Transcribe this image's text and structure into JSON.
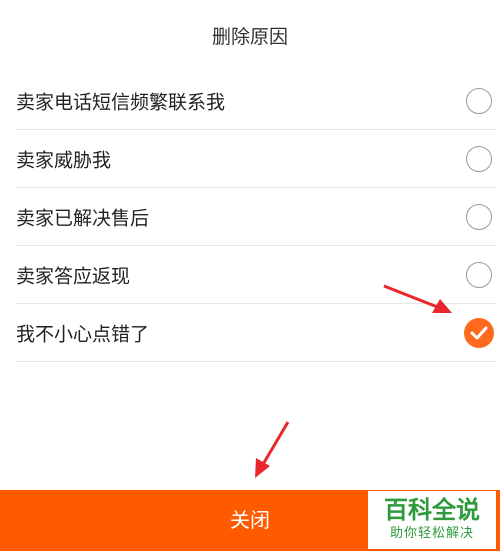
{
  "dialog": {
    "title": "删除原因",
    "options": [
      {
        "label": "卖家电话短信频繁联系我",
        "selected": false
      },
      {
        "label": "卖家威胁我",
        "selected": false
      },
      {
        "label": "卖家已解决售后",
        "selected": false
      },
      {
        "label": "卖家答应返现",
        "selected": false
      },
      {
        "label": "我不小心点错了",
        "selected": true
      }
    ],
    "close_label": "关闭"
  },
  "watermark": {
    "main": "百科全说",
    "sub": "助你轻松解决"
  },
  "colors": {
    "accent": "#ff5a00",
    "check": "#ff6a1f",
    "annotation_arrow": "#e8262b",
    "watermark": "#2e9a3c"
  }
}
